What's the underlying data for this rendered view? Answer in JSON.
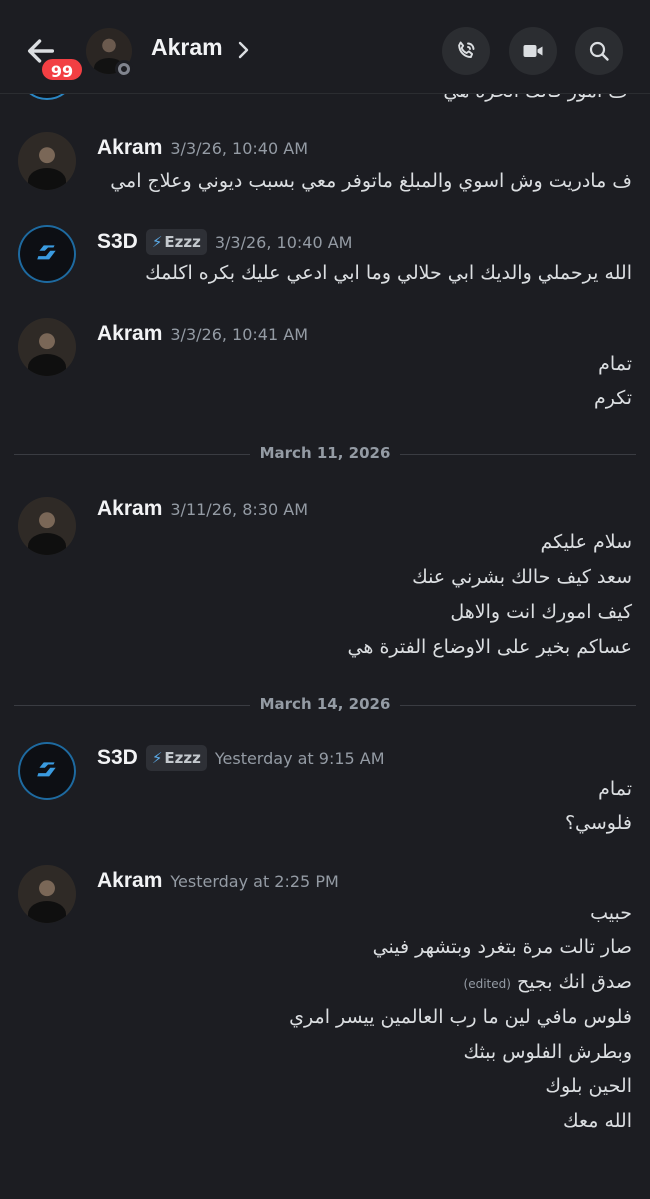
{
  "header": {
    "unread_count": "99",
    "name": "Akram",
    "icons": {
      "back": "arrow-left-icon",
      "call": "phone-call-icon",
      "video": "video-camera-icon",
      "search": "search-icon",
      "chevron": "chevron-right-icon"
    }
  },
  "partial_message": {
    "text": "ف امور فالك الحرة هي"
  },
  "messages": [
    {
      "author": "Akram",
      "time": "3/3/26, 10:40 AM",
      "lines": [
        "ف مادريت وش اسوي والمبلغ ماتوفر معي بسبب ديوني وعلاج امي"
      ]
    },
    {
      "author": "S3D",
      "tag": "Ezzz",
      "time": "3/3/26, 10:40 AM",
      "lines": [
        "الله يرحملي والديك ابي حلالي وما ابي ادعي عليك بكره اكلمك"
      ]
    },
    {
      "author": "Akram",
      "time": "3/3/26, 10:41 AM",
      "lines": [
        "تمام",
        "تكرم"
      ]
    },
    {
      "author": "Akram",
      "time": "3/11/26, 8:30 AM",
      "lines": [
        "سلام عليكم",
        "سعد كيف حالك بشرني عنك",
        "كيف امورك انت والاهل",
        "عساكم بخير على الاوضاع الفترة هي"
      ]
    },
    {
      "author": "S3D",
      "tag": "Ezzz",
      "time": "Yesterday at 9:15 AM",
      "lines": [
        "تمام",
        "فلوسي؟"
      ]
    },
    {
      "author": "Akram",
      "time": "Yesterday at 2:25 PM",
      "lines": [
        "حبيب",
        "صار تالت مرة بتغرد وبتشهر فيني",
        "صدق انك بجيح",
        "فلوس مافي لين ما رب العالمين ييسر امري",
        "وبطرش الفلوس ببثك",
        "الحين بلوك",
        "الله معك"
      ],
      "edited_label": "(edited)"
    }
  ],
  "dividers": [
    "March 11, 2026",
    "March 14, 2026"
  ]
}
